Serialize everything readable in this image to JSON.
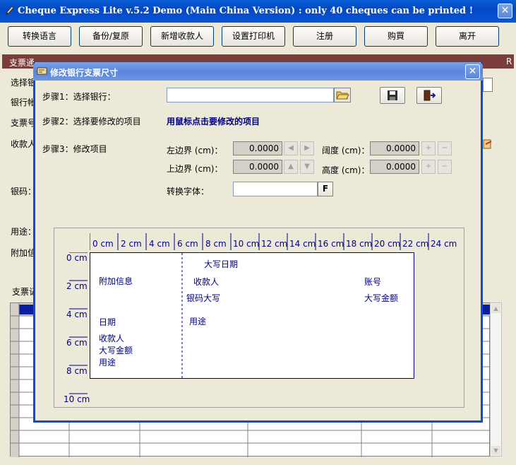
{
  "app": {
    "title": "Cheque Express Lite v.5.2 Demo (Main China Version) : only 40 cheques can be printed !"
  },
  "toolbar": {
    "buttons": [
      "转换语言",
      "备份/复原",
      "新增收款人",
      "设置打印机",
      "注册",
      "购買",
      "离开"
    ]
  },
  "main": {
    "bar_left": "支票通",
    "bar_right": "R",
    "labels": [
      "选择银",
      "银行帐",
      "支票号",
      "收款人",
      "银码：",
      "用途：",
      "附加信",
      "支票记"
    ]
  },
  "dialog": {
    "title": "修改银行支票尺寸",
    "step1": "步骤1：选择银行：",
    "step2": "步骤2：选择要修改的项目",
    "step2_hint": "用鼠标点击要修改的项目",
    "step3": "步骤3：修改项目",
    "bank_value": "",
    "left_label": "左边界 (cm)：",
    "left_value": "0.0000",
    "top_label": "上边界 (cm)：",
    "top_value": "0.0000",
    "width_label": "阔度 (cm)：",
    "width_value": "0.0000",
    "height_label": "高度 (cm)：",
    "height_value": "0.0000",
    "font_label": "转换字体：",
    "font_value": "",
    "font_button": "F",
    "plus": "+",
    "minus": "−"
  },
  "ruler": {
    "top": [
      "0 cm",
      "2 cm",
      "4 cm",
      "6 cm",
      "8 cm",
      "10 cm",
      "12 cm",
      "14 cm",
      "16 cm",
      "18 cm",
      "20 cm",
      "22 cm",
      "24 cm"
    ],
    "left": [
      "0 cm",
      "2 cm",
      "4 cm",
      "6 cm",
      "8 cm",
      "10 cm"
    ]
  },
  "cheque_fields": {
    "date_upper": "大写日期",
    "extra_info": "附加信息",
    "payee1": "收款人",
    "account": "账号",
    "amount_upper1": "银码大写",
    "amount_upper2": "大写金额",
    "purpose1": "用途",
    "date": "日期",
    "payee2": "收款人",
    "amount_upper3": "大写金额",
    "purpose2": "用途"
  }
}
